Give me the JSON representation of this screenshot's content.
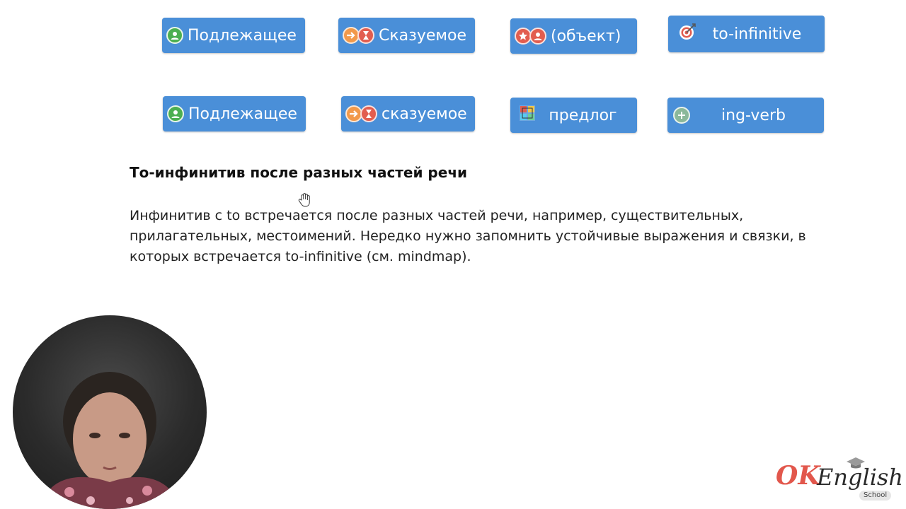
{
  "pills_row1": [
    {
      "label": "Подлежащее",
      "icons": [
        "person-icon"
      ]
    },
    {
      "label": "Сказуемое",
      "icons": [
        "arrow-right-icon",
        "hourglass-icon"
      ]
    },
    {
      "label": "(объект)",
      "icons": [
        "star-icon",
        "person-icon"
      ]
    },
    {
      "label": "to-infinitive",
      "icons": [
        "target-icon"
      ]
    }
  ],
  "pills_row2": [
    {
      "label": "Подлежащее",
      "icons": [
        "person-icon"
      ]
    },
    {
      "label": "сказуемое",
      "icons": [
        "arrow-right-icon",
        "hourglass-icon"
      ]
    },
    {
      "label": "предлог",
      "icons": [
        "grid-icon"
      ]
    },
    {
      "label": "ing-verb",
      "icons": [
        "plus-circle-icon"
      ]
    }
  ],
  "section": {
    "heading": "То-инфинитив после разных частей речи",
    "paragraph": "Инфинитив с to встречается после разных частей речи, например, существительных, прилагательных, местоимений. Нередко нужно запомнить устойчивые выражения и связки, в которых встречается to-infinitive (см. mindmap)."
  },
  "logo": {
    "ok": "OK",
    "english": "English",
    "school": "School"
  },
  "colors": {
    "pill": "#4a8fd8",
    "logo_red": "#e2574c"
  }
}
